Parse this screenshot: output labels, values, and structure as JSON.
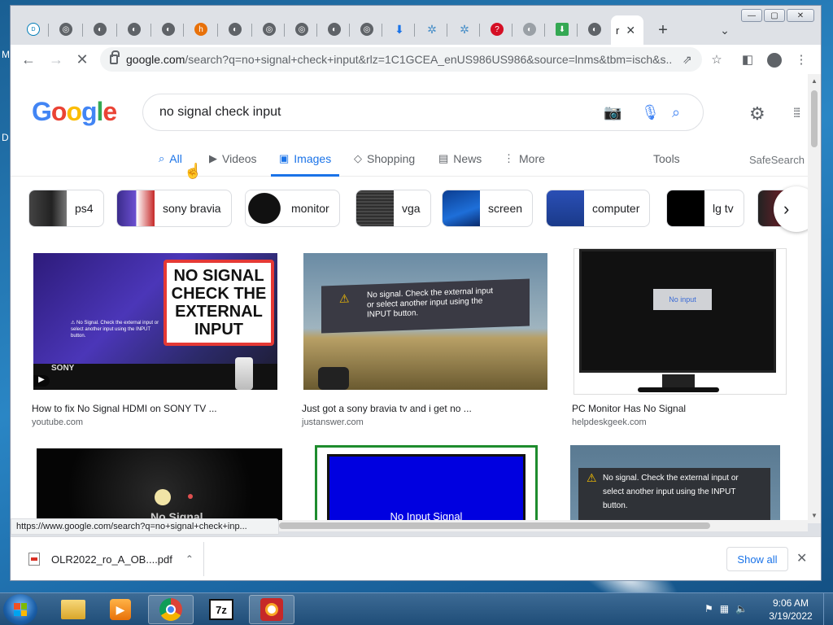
{
  "desktop": {
    "letter_m": "M",
    "letter_d": "D"
  },
  "browser": {
    "active_tab_letter": "r",
    "url_host": "google.com",
    "url_rest": "/search?q=no+signal+check+input&rlz=1C1GCEA_enUS986US986&source=lnms&tbm=isch&s...",
    "status_url": "https://www.google.com/search?q=no+signal+check+inp..."
  },
  "search": {
    "logo": [
      "G",
      "o",
      "o",
      "g",
      "l",
      "e"
    ],
    "logo_colors": [
      "#4285f4",
      "#ea4335",
      "#fbbc05",
      "#4285f4",
      "#34a853",
      "#ea4335"
    ],
    "query": "no signal check input"
  },
  "tabs": [
    {
      "label": "All",
      "icon": "search-icon"
    },
    {
      "label": "Videos",
      "icon": "play-icon"
    },
    {
      "label": "Images",
      "icon": "image-icon"
    },
    {
      "label": "Shopping",
      "icon": "tag-icon"
    },
    {
      "label": "News",
      "icon": "news-icon"
    },
    {
      "label": "More",
      "icon": "more-vertical-icon"
    }
  ],
  "tools_label": "Tools",
  "safesearch_label": "SafeSearch",
  "chips": [
    "ps4",
    "sony bravia",
    "monitor",
    "vga",
    "screen",
    "computer",
    "lg tv"
  ],
  "results": [
    {
      "title": "How to fix No Signal HDMI on SONY TV ...",
      "source": "youtube.com",
      "overlay": [
        "NO SIGNAL",
        "CHECK THE",
        "EXTERNAL",
        "INPUT"
      ],
      "brand": "SONY"
    },
    {
      "title": "Just got a sony bravia tv and i get no ...",
      "source": "justanswer.com",
      "overlay": [
        "No signal. Check the external input",
        "or select another input using the",
        "INPUT button."
      ]
    },
    {
      "title": "PC Monitor Has No Signal",
      "source": "helpdeskgeek.com",
      "overlay": [
        "No input"
      ]
    },
    {
      "overlay": [
        "No Signal"
      ]
    },
    {
      "overlay": [
        "No Input Signal"
      ]
    },
    {
      "overlay": [
        "No signal. Check the external input or",
        "select another input using the INPUT",
        "button."
      ]
    }
  ],
  "download": {
    "filename": "OLR2022_ro_A_OB....pdf",
    "show_all": "Show all"
  },
  "clock": {
    "time": "9:06 AM",
    "date": "3/19/2022"
  }
}
